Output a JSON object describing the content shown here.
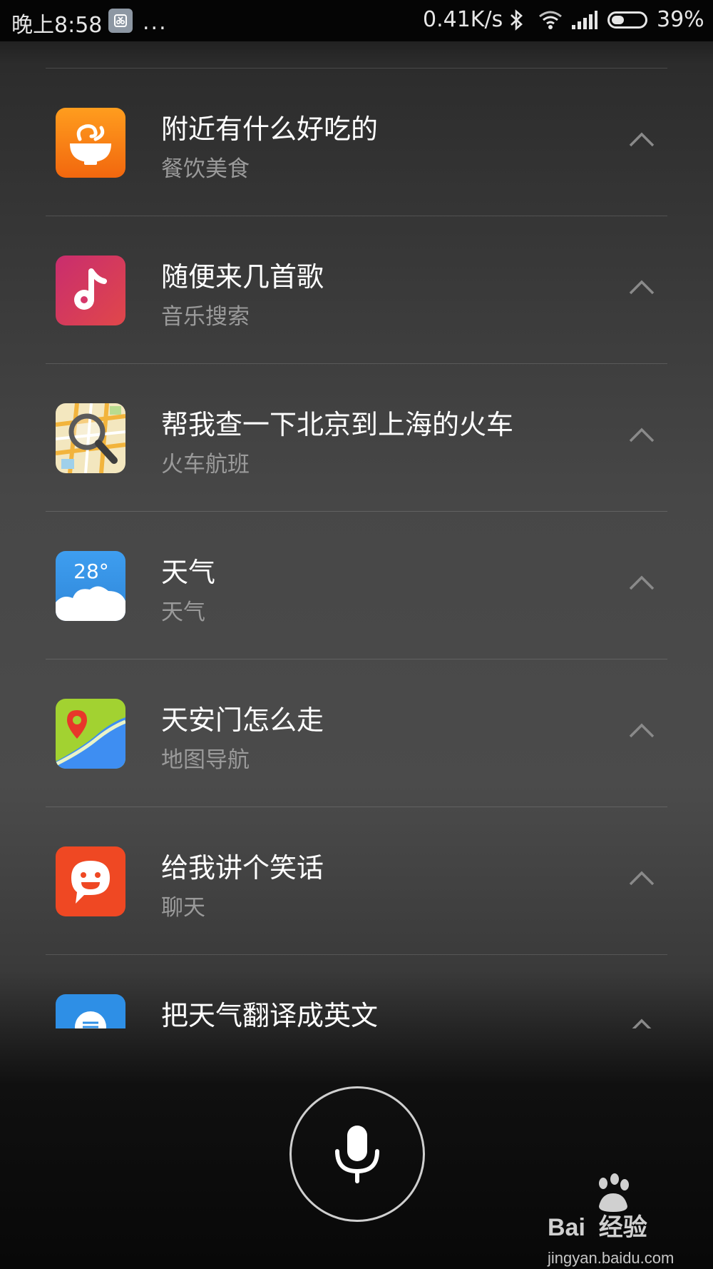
{
  "status_bar": {
    "time": "晚上8:58",
    "more": "...",
    "net_speed": "0.41K/s",
    "battery": "39%",
    "battery_level": 0.39
  },
  "items": [
    {
      "title": "附近有什么好吃的",
      "subtitle": "餐饮美食",
      "icon": "food-bowl-icon"
    },
    {
      "title": "随便来几首歌",
      "subtitle": "音乐搜索",
      "icon": "music-note-icon"
    },
    {
      "title": "帮我查一下北京到上海的火车",
      "subtitle": "火车航班",
      "icon": "map-search-icon"
    },
    {
      "title": "天气",
      "subtitle": "天气",
      "icon": "weather-icon",
      "icon_text": "28°"
    },
    {
      "title": "天安门怎么走",
      "subtitle": "地图导航",
      "icon": "map-pin-icon"
    },
    {
      "title": "给我讲个笑话",
      "subtitle": "聊天",
      "icon": "chat-face-icon"
    },
    {
      "title": "把天气翻译成英文",
      "subtitle": "",
      "icon": "translate-icon"
    }
  ],
  "watermark": {
    "brand": "Bai  经验",
    "url": "jingyan.baidu.com"
  },
  "colors": {
    "food": "#f47d18",
    "music": "#d6386a",
    "weather": "#3a9ae6",
    "map_green": "#9fd12f",
    "map_blue": "#3e8ef2",
    "chat": "#ef4823",
    "translate": "#2e8fe6"
  }
}
